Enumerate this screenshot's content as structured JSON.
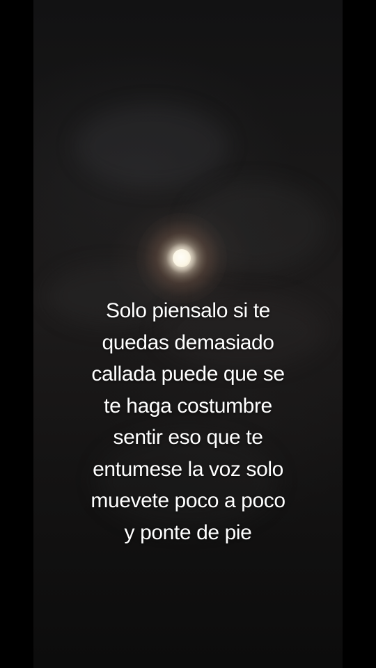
{
  "caption": {
    "lines": [
      "Solo piensalo si te",
      "quedas demasiado",
      "callada puede que se",
      "te haga costumbre",
      "sentir eso que te",
      "entumese la voz solo",
      "muevete poco a poco",
      "y ponte de pie"
    ]
  },
  "colors": {
    "background": "#000000",
    "caption_text": "#ffffff",
    "moon": "#fbf6e6"
  }
}
